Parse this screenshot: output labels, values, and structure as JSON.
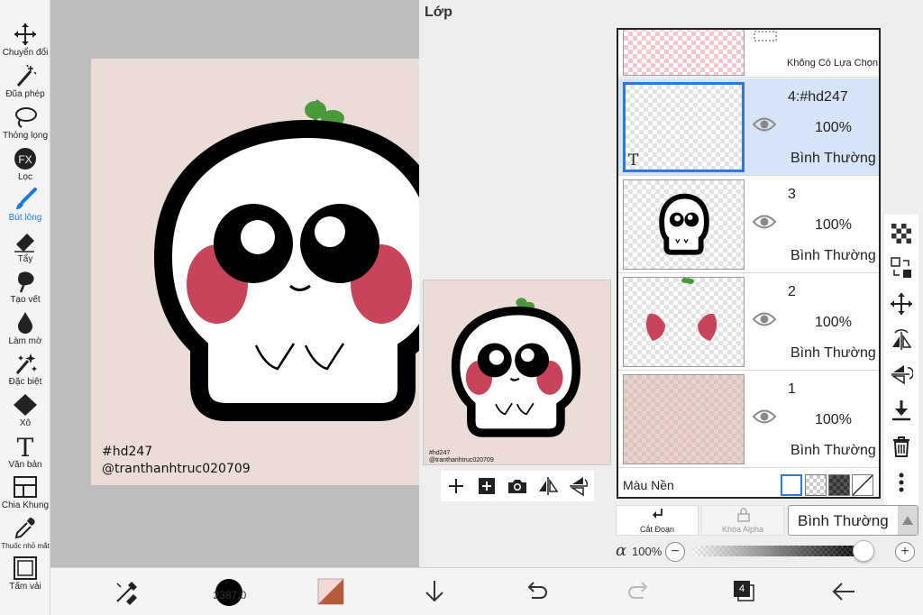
{
  "toolbar": {
    "tools": [
      {
        "label": "Chuyển đổi",
        "icon": "move-icon"
      },
      {
        "label": "Đũa phép",
        "icon": "magic-wand-icon"
      },
      {
        "label": "Thòng lọng",
        "icon": "lasso-icon"
      },
      {
        "label": "Lọc",
        "icon": "fx-filter-icon",
        "icon_text": "FX"
      },
      {
        "label": "Bút lông",
        "icon": "brush-icon",
        "active": true
      },
      {
        "label": "Tẩy",
        "icon": "eraser-icon"
      },
      {
        "label": "Tạo vết",
        "icon": "smudge-icon"
      },
      {
        "label": "Làm mờ",
        "icon": "blur-drop-icon"
      },
      {
        "label": "Đặc biệt",
        "icon": "sparkle-icon"
      },
      {
        "label": "Xô",
        "icon": "bucket-icon"
      },
      {
        "label": "Văn bản",
        "icon": "text-tool-icon",
        "icon_text": "T"
      },
      {
        "label": "Chia Khung",
        "icon": "frame-divider-icon"
      },
      {
        "label": "Thuốc nhỏ mắt",
        "icon": "eyedropper-icon"
      },
      {
        "label": "Tấm vải",
        "icon": "canvas-icon"
      }
    ]
  },
  "canvas": {
    "watermark_line1": "#hd247",
    "watermark_line2": "@tranthanhtruc020709"
  },
  "layers_panel": {
    "title": "Lớp",
    "preview": {
      "watermark_line1": "#hd247",
      "watermark_line2": "@tranthanhtruc020709"
    },
    "selection_row": {
      "label": "Không Có Lựa Chọn"
    },
    "layers": [
      {
        "name": "4:#hd247",
        "opacity": "100%",
        "mode": "Bình Thường",
        "selected": true,
        "is_text": true,
        "text_marker": "T"
      },
      {
        "name": "3",
        "opacity": "100%",
        "mode": "Bình Thường"
      },
      {
        "name": "2",
        "opacity": "100%",
        "mode": "Bình Thường"
      },
      {
        "name": "1",
        "opacity": "100%",
        "mode": "Bình Thường"
      }
    ],
    "background": {
      "label": "Màu Nền"
    },
    "cut_button": "Cắt Đoạn",
    "alpha_lock_button": "Khóa Alpha",
    "blend_mode": "Bình Thường",
    "opacity_symbol": "α",
    "opacity_value": "100%",
    "opacity_fraction": 1.0,
    "minus": "−",
    "plus": "+"
  },
  "bottom_bar": {
    "brush_size": "2387.0",
    "layer_count": "4"
  },
  "colors": {
    "accent": "#1d7be0",
    "blush": "#c8445a",
    "sprout": "#4a9a3c",
    "canvas_bg": "#ecdcd7",
    "selected_layer": "#d6e4f7"
  }
}
